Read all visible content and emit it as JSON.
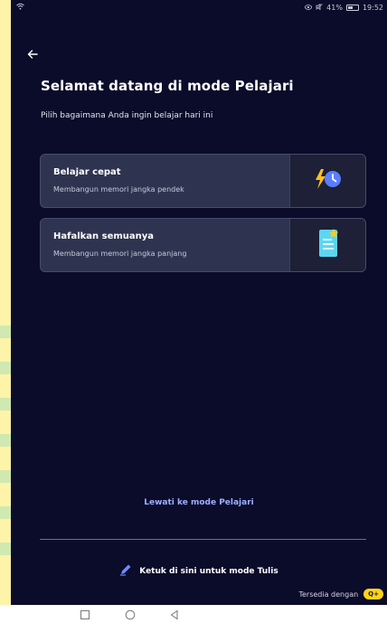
{
  "status_bar": {
    "battery": "41%",
    "time": "19:52",
    "icons": [
      "wifi-icon",
      "eye-icon",
      "mute-icon",
      "battery-icon"
    ]
  },
  "header": {
    "title": "Selamat datang di mode Pelajari",
    "subtitle": "Pilih bagaimana Anda ingin belajar hari ini"
  },
  "options": [
    {
      "title": "Belajar cepat",
      "description": "Membangun memori jangka pendek",
      "icon": "lightning-clock-icon"
    },
    {
      "title": "Hafalkan semuanya",
      "description": "Membangun memori jangka panjang",
      "icon": "document-star-icon"
    }
  ],
  "footer": {
    "skip_label": "Lewati ke mode Pelajari",
    "write_mode_label": "Ketuk di sini untuk mode Tulis",
    "available_label": "Tersedia dengan",
    "badge_label": "Q+"
  },
  "colors": {
    "background": "#0b0b2a",
    "card": "#2e3450",
    "accent_link": "#9db0ff",
    "badge": "#ffd31a"
  },
  "nav_bar": {
    "buttons": [
      "square-icon",
      "circle-icon",
      "triangle-back-icon"
    ]
  }
}
